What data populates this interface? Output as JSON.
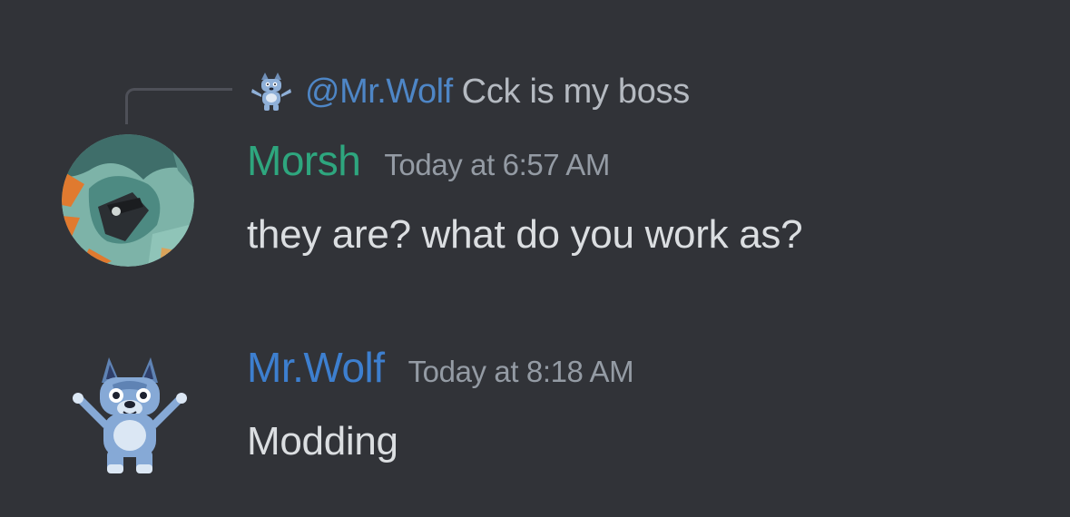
{
  "messages": [
    {
      "reply": {
        "mention": "@Mr.Wolf",
        "text": "Cck is my boss",
        "avatar_icon": "bluey-dog-avatar-icon"
      },
      "author": "Morsh",
      "author_color": "#2ea67e",
      "timestamp": "Today at 6:57 AM",
      "content": "they are? what do you work as?",
      "avatar_icon": "morsh-avatar-icon"
    },
    {
      "author": "Mr.Wolf",
      "author_color": "#3d7fcf",
      "timestamp": "Today at 8:18 AM",
      "content": "Modding",
      "avatar_icon": "bluey-dog-avatar-icon"
    }
  ],
  "theme": {
    "background": "#313338",
    "text": "#dbdee1",
    "muted": "#949ba4",
    "mention": "#4e86c6"
  }
}
